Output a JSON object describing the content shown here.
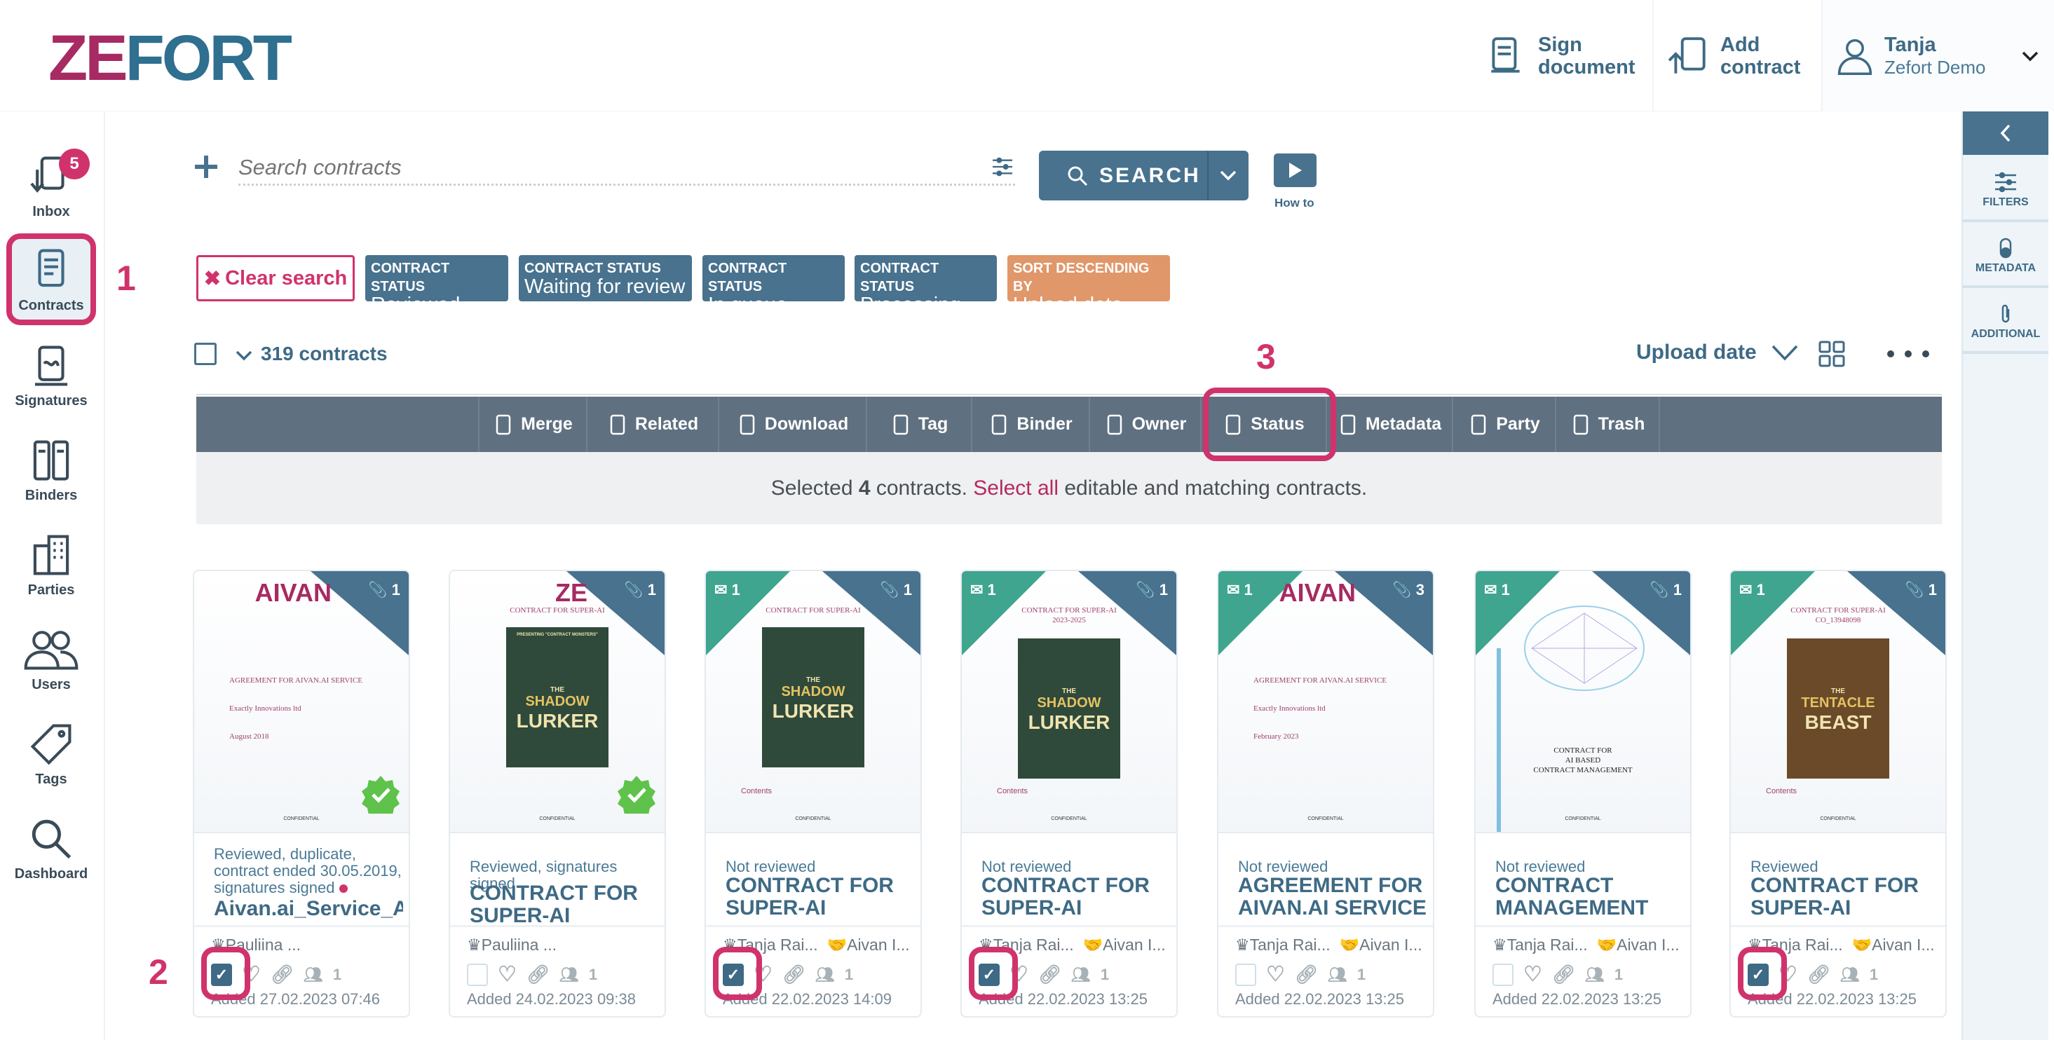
{
  "header": {
    "logo": "ZEFORT",
    "sign_document": "Sign document",
    "add_contract": "Add contract",
    "user_name": "Tanja",
    "user_org": "Zefort Demo"
  },
  "sidebar": {
    "inbox_badge": "5",
    "items": [
      {
        "label": "Inbox"
      },
      {
        "label": "Contracts"
      },
      {
        "label": "Signatures"
      },
      {
        "label": "Binders"
      },
      {
        "label": "Parties"
      },
      {
        "label": "Users"
      },
      {
        "label": "Tags"
      },
      {
        "label": "Dashboard"
      }
    ]
  },
  "right_panel": {
    "filters": "FILTERS",
    "metadata": "METADATA",
    "additional": "ADDITIONAL"
  },
  "search": {
    "placeholder": "Search contracts",
    "button": "SEARCH",
    "how_to": "How to"
  },
  "chips": {
    "clear": "Clear search",
    "items": [
      {
        "key": "CONTRACT STATUS",
        "value": "Reviewed"
      },
      {
        "key": "CONTRACT STATUS",
        "value": "Waiting for review"
      },
      {
        "key": "CONTRACT STATUS",
        "value": "In queue"
      },
      {
        "key": "CONTRACT STATUS",
        "value": "Processing"
      },
      {
        "key": "SORT DESCENDING BY",
        "value": "Upload date"
      }
    ]
  },
  "annotations": {
    "one": "1",
    "two": "2",
    "three": "3"
  },
  "list": {
    "count": "319 contracts",
    "sort": "Upload date"
  },
  "toolbar": [
    "Merge",
    "Related",
    "Download",
    "Tag",
    "Binder",
    "Owner",
    "Status",
    "Metadata",
    "Party",
    "Trash"
  ],
  "selection": {
    "pre": "Selected ",
    "count": "4",
    "mid": " contracts. ",
    "link": "Select all",
    "post": " editable and matching contracts."
  },
  "colors": {
    "primary": "#48728e",
    "accent": "#d0336c",
    "sort_chip": "#e0976a",
    "teal": "#3fa58f"
  },
  "cards": [
    {
      "thumb_logo": "AIVAN",
      "thumb_lines": [
        "AGREEMENT FOR AIVAN.AI SERVICE",
        "Exactly Innovations ltd",
        "August 2018"
      ],
      "thumb_footer": "CONFIDENTIAL",
      "attachments": "1",
      "messages": null,
      "verified": true,
      "poster": null,
      "status": "Reviewed, duplicate, contract ended 30.05.2019, signatures signed",
      "status_dot": true,
      "title": "Aivan.ai_Service_Agreement",
      "owner": "Pauliina ...",
      "party": null,
      "checked": true,
      "users": "1",
      "added": "Added 27.02.2023 07:46"
    },
    {
      "thumb_logo": "ZE",
      "thumb_lines": [
        "CONTRACT FOR SUPER-AI"
      ],
      "thumb_footer": "CONFIDENTIAL",
      "attachments": "1",
      "messages": null,
      "verified": true,
      "poster": {
        "pre": "PRESENTING \"CONTRACT MONSTERS\"",
        "the": "THE",
        "a": "SHADOW",
        "b": "LURKER",
        "color": "#2f4a3a"
      },
      "status": "Reviewed, signatures signed",
      "title": "CONTRACT FOR SUPER-AI",
      "owner": "Pauliina ...",
      "party": null,
      "checked": false,
      "users": "1",
      "added": "Added 24.02.2023 09:38"
    },
    {
      "thumb_logo": null,
      "thumb_lines": [
        "CONTRACT FOR SUPER-AI"
      ],
      "thumb_footer": "CONFIDENTIAL",
      "contents": "Contents",
      "attachments": "1",
      "messages": "1",
      "poster": {
        "the": "THE",
        "a": "SHADOW",
        "b": "LURKER",
        "color": "#2f4a3a"
      },
      "status": "Not reviewed",
      "title": "CONTRACT FOR SUPER-AI",
      "owner": "Tanja Rai...",
      "party": "Aivan I...",
      "checked": true,
      "users": "1",
      "added": "Added 22.02.2023 14:09"
    },
    {
      "thumb_logo": null,
      "thumb_lines": [
        "CONTRACT FOR SUPER-AI",
        "2023-2025"
      ],
      "thumb_footer": "CONFIDENTIAL",
      "contents": "Contents",
      "attachments": "1",
      "messages": "1",
      "poster": {
        "the": "THE",
        "a": "SHADOW",
        "b": "LURKER",
        "color": "#2f4a3a"
      },
      "status": "Not reviewed",
      "title": "CONTRACT FOR SUPER-AI",
      "owner": "Tanja Rai...",
      "party": "Aivan I...",
      "checked": true,
      "users": "1",
      "added": "Added 22.02.2023 13:25"
    },
    {
      "thumb_logo": "AIVAN",
      "thumb_lines": [
        "AGREEMENT FOR AIVAN.AI SERVICE",
        "Exactly Innovations ltd",
        "February 2023"
      ],
      "thumb_footer": "CONFIDENTIAL",
      "attachments": "3",
      "messages": "1",
      "poster": null,
      "status": "Not reviewed",
      "title": "AGREEMENT FOR AIVAN.AI SERVICE",
      "owner": "Tanja Rai...",
      "party": "Aivan I...",
      "checked": false,
      "users": "1",
      "added": "Added 22.02.2023 13:25"
    },
    {
      "thumb_logo": null,
      "thumb_lines": [
        "CONTRACT FOR",
        "AI BASED",
        "CONTRACT MANAGEMENT"
      ],
      "thumb_footer": "CONFIDENTIAL",
      "attachments": "1",
      "messages": "1",
      "poster": null,
      "brain": true,
      "status": "Not reviewed",
      "title": "CONTRACT MANAGEMENT",
      "owner": "Tanja Rai...",
      "party": "Aivan I...",
      "checked": false,
      "users": "1",
      "added": "Added 22.02.2023 13:25"
    },
    {
      "thumb_logo": null,
      "thumb_lines": [
        "CONTRACT FOR SUPER-AI",
        "CO_13948098"
      ],
      "thumb_footer": "CONFIDENTIAL",
      "contents": "Contents",
      "attachments": "1",
      "messages": "1",
      "poster": {
        "the": "THE",
        "a": "TENTACLE",
        "b": "BEAST",
        "color": "#6b4a2a"
      },
      "status": "Reviewed",
      "title": "CONTRACT FOR SUPER-AI",
      "owner": "Tanja Rai...",
      "party": "Aivan I...",
      "checked": true,
      "users": "1",
      "added": "Added 22.02.2023 13:25"
    }
  ]
}
